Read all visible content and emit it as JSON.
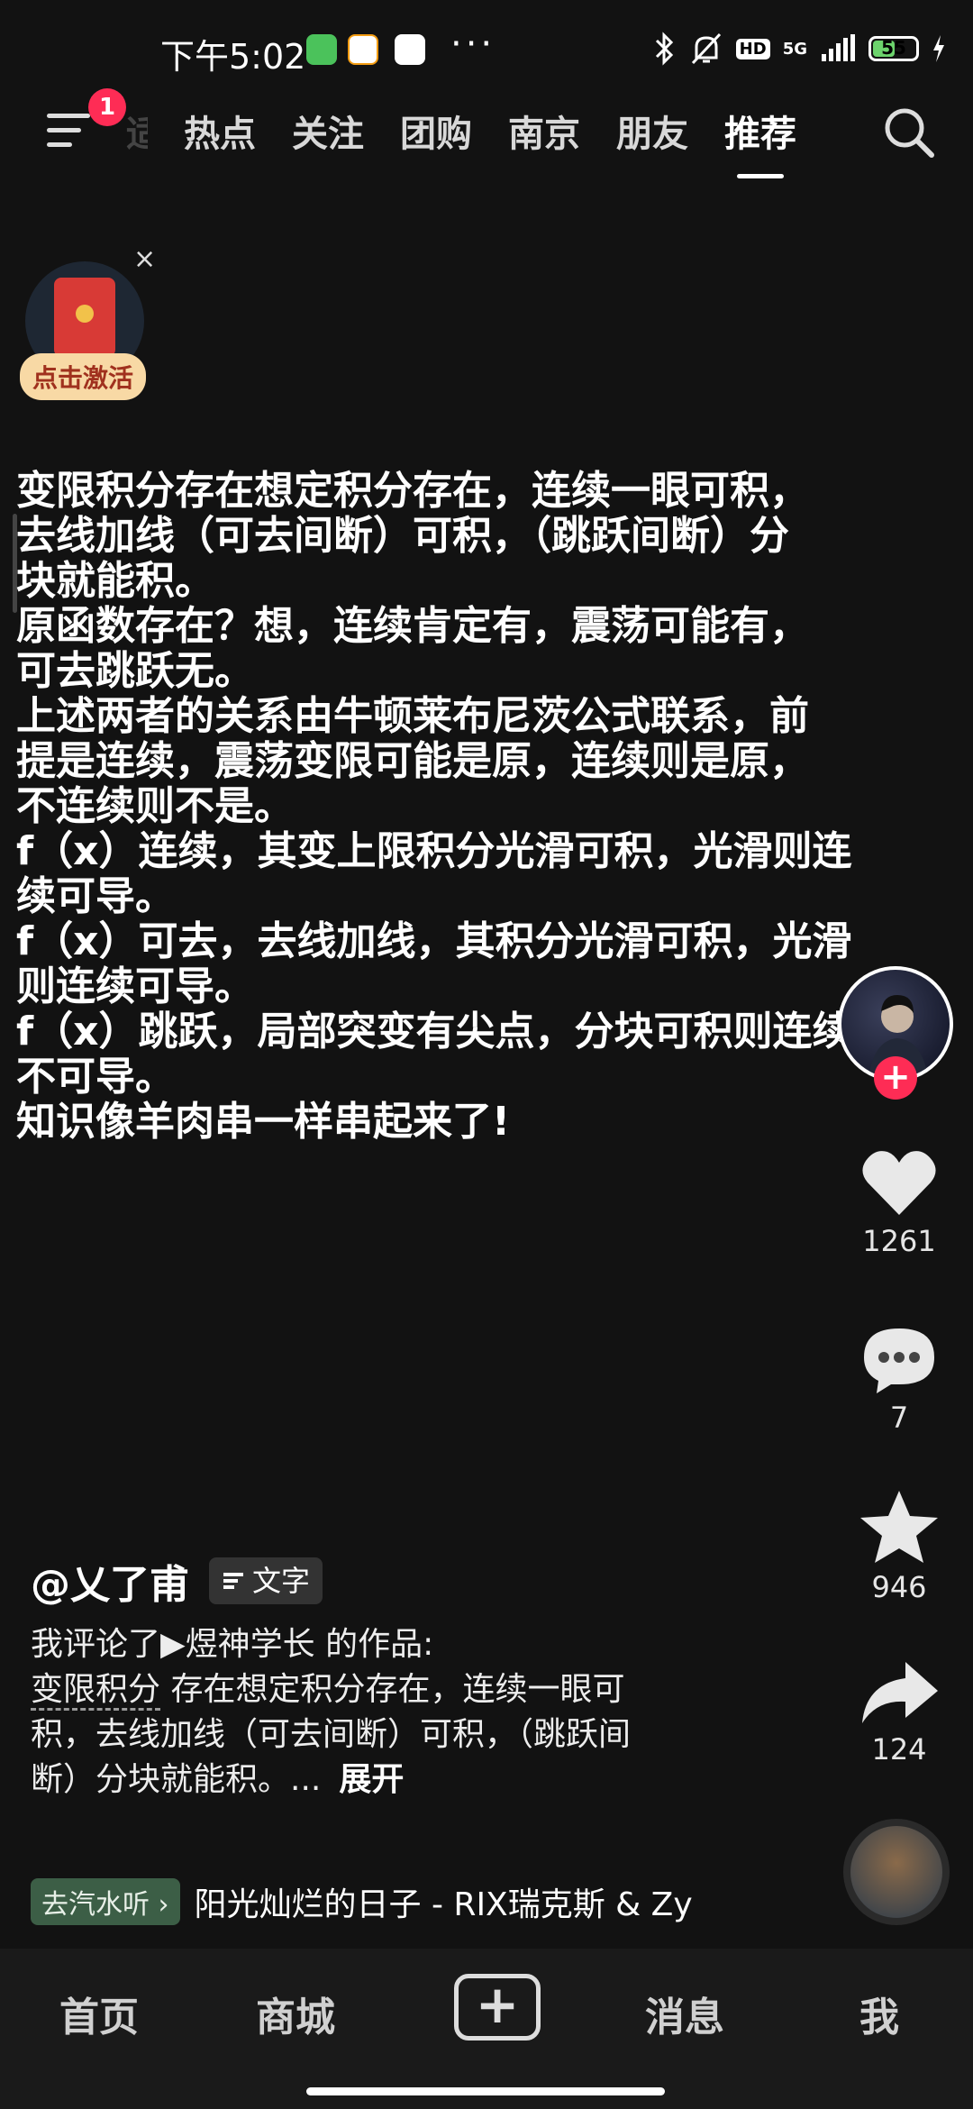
{
  "status_bar": {
    "time": "下午5:02",
    "app_icons": [
      "wechat-app-icon",
      "58-app-icon",
      "baidu-netdisk-app-icon"
    ],
    "more": "···",
    "network": "5G",
    "hd": "HD",
    "battery": "55",
    "battery_level": 0.55
  },
  "top_nav": {
    "notification_count": "1",
    "tabs": [
      "适",
      "热点",
      "关注",
      "团购",
      "南京",
      "朋友",
      "推荐"
    ],
    "active_tab": "推荐"
  },
  "red_packet": {
    "label": "点击激活",
    "close": "×"
  },
  "post": {
    "lines": [
      "变限积分存在想定积分存在，连续一眼可积，",
      "去线加线（可去间断）可积，（跳跃间断）分",
      "块就能积。",
      "原函数存在？想，连续肯定有，震荡可能有，",
      "可去跳跃无。",
      "上述两者的关系由牛顿莱布尼茨公式联系，前",
      "提是连续，震荡变限可能是原，连续则是原，",
      "不连续则不是。",
      "f（x）连续，其变上限积分光滑可积，光滑则连",
      "续可导。",
      "f（x）可去，去线加线，其积分光滑可积，光滑",
      "则连续可导。",
      "f（x）跳跃，局部突变有尖点，分块可积则连续",
      "不可导。",
      "知识像羊肉串一样串起来了!"
    ]
  },
  "actions": {
    "follow": "+",
    "likes": "1261",
    "comments": "7",
    "favorites": "946",
    "shares": "124"
  },
  "author": {
    "name": "@乂了甫",
    "type_badge": "文字"
  },
  "caption": {
    "line1": "我评论了▶煜神学长 的作品:",
    "keyword": "变限积分",
    "line2_rest": " 存在想定积分存在，连续一眼可",
    "line3": "积，去线加线（可去间断）可积，（跳跃间",
    "line4": "断）分块就能积。...",
    "expand": "展开"
  },
  "music": {
    "tag": "去汽水听 ›",
    "title": "阳光灿烂的日子 - RIX瑞克斯 & Zy"
  },
  "bottom_nav": {
    "home": "首页",
    "mall": "商城",
    "add": "+",
    "messages": "消息",
    "me": "我"
  }
}
